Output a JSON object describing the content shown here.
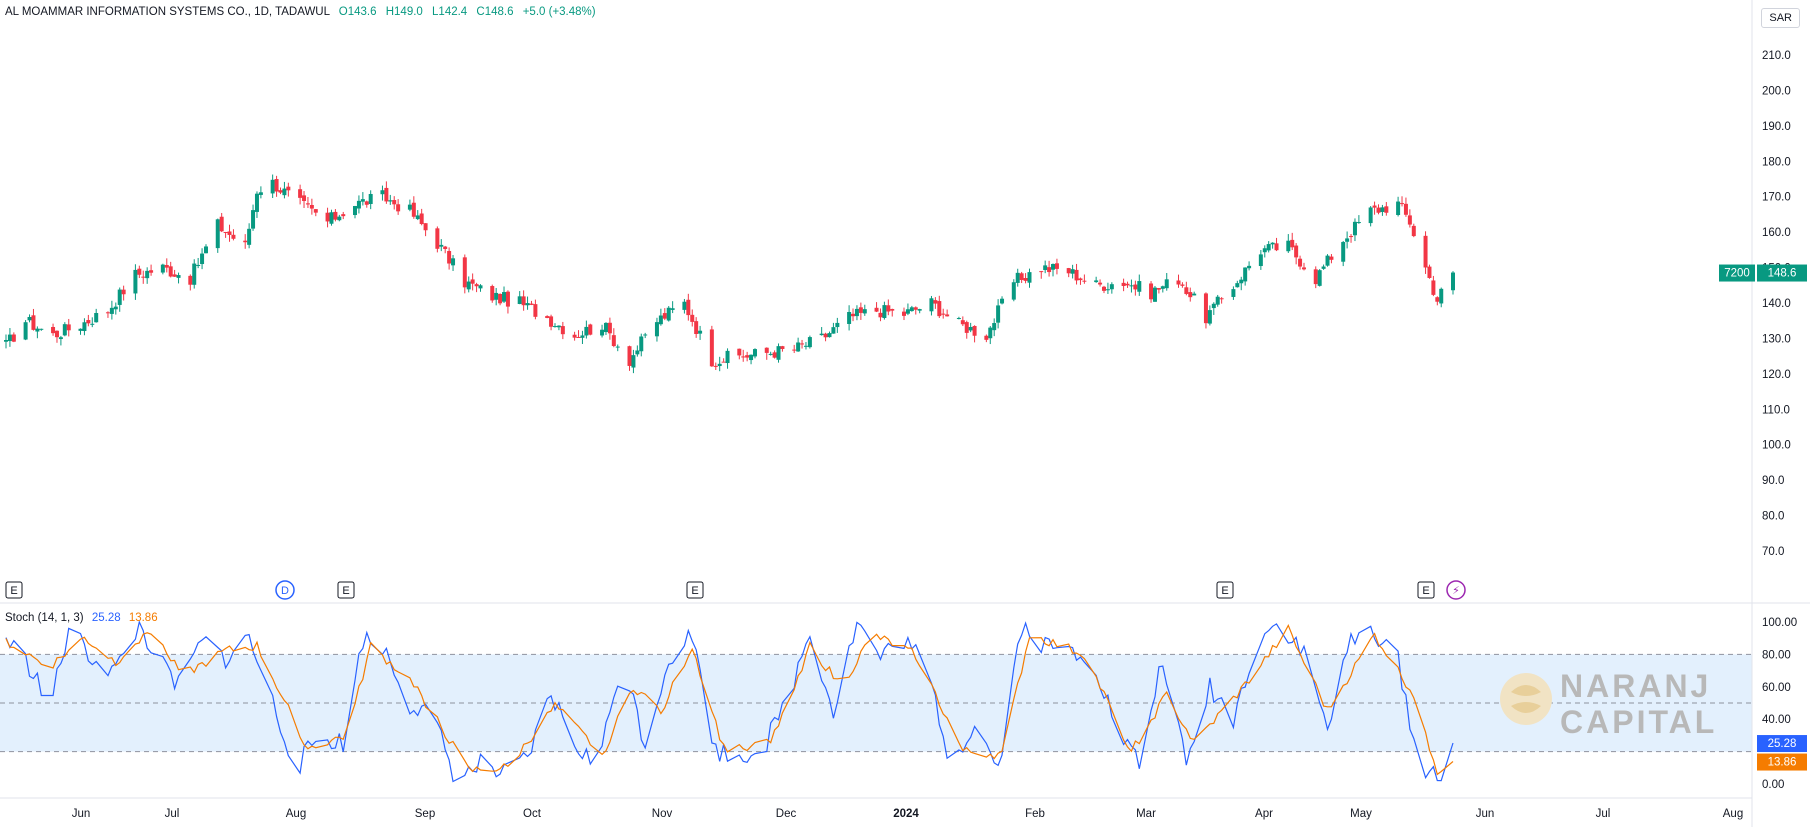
{
  "header": {
    "symbol": "AL MOAMMAR INFORMATION SYSTEMS CO., 1D, TADAWUL",
    "open": "O143.6",
    "high": "H149.0",
    "low": "L142.4",
    "close": "C148.6",
    "change": "+5.0 (+3.48%)"
  },
  "currency": "SAR",
  "price_tag": {
    "ticker": "7200",
    "value": "148.6",
    "color": "#089981"
  },
  "stoch": {
    "label": "Stoch (14, 1, 3)",
    "k_value": "25.28",
    "d_value": "13.86",
    "k_color": "#2962ff",
    "d_color": "#f57c00"
  },
  "event_markers": [
    "E",
    "D",
    "E",
    "E",
    "E",
    "E",
    "⚡"
  ],
  "watermark": {
    "line1": "NARANJ",
    "line2": "CAPITAL"
  },
  "chart_data": [
    {
      "type": "candlestick",
      "title": "AL MOAMMAR INFORMATION SYSTEMS CO., 1D, TADAWUL",
      "ylim": [
        70,
        210
      ],
      "yticks": [
        "210.0",
        "200.0",
        "190.0",
        "180.0",
        "170.0",
        "160.0",
        "150.0",
        "140.0",
        "130.0",
        "120.0",
        "110.0",
        "100.0",
        "90.0",
        "80.0",
        "70.0"
      ],
      "xticks": [
        "Jun",
        "Jul",
        "Aug",
        "Sep",
        "Oct",
        "Nov",
        "Dec",
        "2024",
        "Feb",
        "Mar",
        "Apr",
        "May",
        "Jun",
        "Jul",
        "Aug"
      ],
      "up_color": "#089981",
      "down_color": "#f23645",
      "close_anchors": [
        [
          "2023-05-23",
          128
        ],
        [
          "2023-05-28",
          135
        ],
        [
          "2023-06-04",
          131
        ],
        [
          "2023-06-11",
          134
        ],
        [
          "2023-06-18",
          138
        ],
        [
          "2023-06-25",
          148
        ],
        [
          "2023-07-02",
          150
        ],
        [
          "2023-07-09",
          147
        ],
        [
          "2023-07-16",
          162
        ],
        [
          "2023-07-23",
          156
        ],
        [
          "2023-07-26",
          172
        ],
        [
          "2023-07-30",
          174
        ],
        [
          "2023-08-06",
          168
        ],
        [
          "2023-08-13",
          163
        ],
        [
          "2023-08-20",
          168
        ],
        [
          "2023-08-27",
          170
        ],
        [
          "2023-09-03",
          166
        ],
        [
          "2023-09-10",
          157
        ],
        [
          "2023-09-17",
          146
        ],
        [
          "2023-09-24",
          142
        ],
        [
          "2023-10-01",
          140
        ],
        [
          "2023-10-08",
          136
        ],
        [
          "2023-10-15",
          131
        ],
        [
          "2023-10-22",
          134
        ],
        [
          "2023-10-29",
          124
        ],
        [
          "2023-11-05",
          135
        ],
        [
          "2023-11-12",
          140
        ],
        [
          "2023-11-19",
          124
        ],
        [
          "2023-11-26",
          125
        ],
        [
          "2023-12-03",
          126
        ],
        [
          "2023-12-10",
          127
        ],
        [
          "2023-12-17",
          130
        ],
        [
          "2023-12-24",
          136
        ],
        [
          "2023-12-31",
          138
        ],
        [
          "2024-01-07",
          137
        ],
        [
          "2024-01-14",
          140
        ],
        [
          "2024-01-21",
          134
        ],
        [
          "2024-01-28",
          131
        ],
        [
          "2024-02-04",
          146
        ],
        [
          "2024-02-11",
          150
        ],
        [
          "2024-02-18",
          149
        ],
        [
          "2024-02-25",
          145
        ],
        [
          "2024-03-03",
          146
        ],
        [
          "2024-03-10",
          143
        ],
        [
          "2024-03-17",
          147
        ],
        [
          "2024-03-24",
          136
        ],
        [
          "2024-03-31",
          145
        ],
        [
          "2024-04-07",
          155
        ],
        [
          "2024-04-14",
          156
        ],
        [
          "2024-04-21",
          147
        ],
        [
          "2024-04-28",
          158
        ],
        [
          "2024-05-05",
          166
        ],
        [
          "2024-05-12",
          168
        ],
        [
          "2024-05-15",
          163
        ],
        [
          "2024-05-19",
          150
        ],
        [
          "2024-05-22",
          141
        ],
        [
          "2024-05-26",
          148.6
        ]
      ]
    },
    {
      "type": "line",
      "title": "Stoch (14, 1, 3)",
      "ylim": [
        0,
        100
      ],
      "yticks": [
        "100.00",
        "80.00",
        "60.00",
        "40.00",
        "0.00"
      ],
      "bands": [
        20,
        50,
        80
      ],
      "series": [
        {
          "name": "%K",
          "color": "#2962ff",
          "anchors": [
            [
              "2023-05-23",
              90
            ],
            [
              "2023-05-30",
              70
            ],
            [
              "2023-06-03",
              45
            ],
            [
              "2023-06-08",
              95
            ],
            [
              "2023-06-14",
              78
            ],
            [
              "2023-06-20",
              70
            ],
            [
              "2023-06-26",
              98
            ],
            [
              "2023-07-02",
              72
            ],
            [
              "2023-07-06",
              60
            ],
            [
              "2023-07-12",
              88
            ],
            [
              "2023-07-18",
              78
            ],
            [
              "2023-07-24",
              90
            ],
            [
              "2023-07-30",
              50
            ],
            [
              "2023-08-05",
              10
            ],
            [
              "2023-08-11",
              30
            ],
            [
              "2023-08-17",
              25
            ],
            [
              "2023-08-22",
              90
            ],
            [
              "2023-08-28",
              82
            ],
            [
              "2023-09-03",
              50
            ],
            [
              "2023-09-09",
              40
            ],
            [
              "2023-09-15",
              2
            ],
            [
              "2023-09-21",
              12
            ],
            [
              "2023-09-27",
              5
            ],
            [
              "2023-10-03",
              15
            ],
            [
              "2023-10-09",
              55
            ],
            [
              "2023-10-15",
              25
            ],
            [
              "2023-10-21",
              10
            ],
            [
              "2023-10-27",
              78
            ],
            [
              "2023-11-02",
              25
            ],
            [
              "2023-11-08",
              78
            ],
            [
              "2023-11-14",
              92
            ],
            [
              "2023-11-20",
              20
            ],
            [
              "2023-11-26",
              18
            ],
            [
              "2023-12-02",
              22
            ],
            [
              "2023-12-08",
              50
            ],
            [
              "2023-12-14",
              95
            ],
            [
              "2023-12-20",
              45
            ],
            [
              "2023-12-26",
              100
            ],
            [
              "2024-01-01",
              78
            ],
            [
              "2024-01-07",
              90
            ],
            [
              "2024-01-13",
              70
            ],
            [
              "2024-01-19",
              12
            ],
            [
              "2024-01-25",
              38
            ],
            [
              "2024-01-31",
              10
            ],
            [
              "2024-02-06",
              98
            ],
            [
              "2024-02-12",
              85
            ],
            [
              "2024-02-18",
              82
            ],
            [
              "2024-02-24",
              80
            ],
            [
              "2024-03-01",
              35
            ],
            [
              "2024-03-07",
              12
            ],
            [
              "2024-03-13",
              78
            ],
            [
              "2024-03-19",
              10
            ],
            [
              "2024-03-25",
              60
            ],
            [
              "2024-03-31",
              40
            ],
            [
              "2024-04-06",
              90
            ],
            [
              "2024-04-12",
              100
            ],
            [
              "2024-04-18",
              80
            ],
            [
              "2024-04-24",
              35
            ],
            [
              "2024-04-30",
              88
            ],
            [
              "2024-05-06",
              95
            ],
            [
              "2024-05-12",
              75
            ],
            [
              "2024-05-18",
              5
            ],
            [
              "2024-05-23",
              8
            ],
            [
              "2024-05-26",
              25.28
            ]
          ]
        },
        {
          "name": "%D",
          "color": "#f57c00",
          "anchors": [
            [
              "2023-05-23",
              88
            ],
            [
              "2023-06-03",
              72
            ],
            [
              "2023-06-12",
              90
            ],
            [
              "2023-06-20",
              75
            ],
            [
              "2023-06-28",
              95
            ],
            [
              "2023-07-08",
              68
            ],
            [
              "2023-07-18",
              82
            ],
            [
              "2023-07-26",
              85
            ],
            [
              "2023-08-08",
              22
            ],
            [
              "2023-08-18",
              30
            ],
            [
              "2023-08-24",
              85
            ],
            [
              "2023-09-04",
              62
            ],
            [
              "2023-09-18",
              8
            ],
            [
              "2023-09-28",
              10
            ],
            [
              "2023-10-10",
              48
            ],
            [
              "2023-10-22",
              18
            ],
            [
              "2023-10-30",
              60
            ],
            [
              "2023-11-06",
              45
            ],
            [
              "2023-11-14",
              85
            ],
            [
              "2023-11-22",
              22
            ],
            [
              "2023-12-04",
              25
            ],
            [
              "2023-12-14",
              85
            ],
            [
              "2023-12-22",
              60
            ],
            [
              "2023-12-30",
              92
            ],
            [
              "2024-01-10",
              80
            ],
            [
              "2024-01-22",
              20
            ],
            [
              "2024-02-01",
              18
            ],
            [
              "2024-02-08",
              92
            ],
            [
              "2024-02-22",
              80
            ],
            [
              "2024-03-05",
              20
            ],
            [
              "2024-03-14",
              55
            ],
            [
              "2024-03-21",
              25
            ],
            [
              "2024-04-02",
              58
            ],
            [
              "2024-04-14",
              95
            ],
            [
              "2024-04-24",
              45
            ],
            [
              "2024-05-06",
              92
            ],
            [
              "2024-05-16",
              55
            ],
            [
              "2024-05-22",
              8
            ],
            [
              "2024-05-26",
              13.86
            ]
          ]
        }
      ]
    }
  ]
}
